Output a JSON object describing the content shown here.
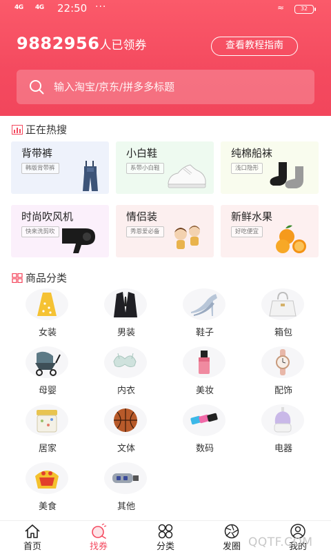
{
  "status_bar": {
    "signal1": "4G",
    "signal2": "4G",
    "time": "22:50",
    "dots": "···",
    "battery": "32"
  },
  "header": {
    "coupon_count": "9882956",
    "coupon_suffix": "人已领券",
    "guide_button": "查看教程指南",
    "search_placeholder": "输入淘宝/京东/拼多多标题",
    "accent_color": "#f44a5f"
  },
  "hot_search": {
    "title": "正在热搜",
    "items": [
      {
        "name": "背带裤",
        "tag": "韩版背带裤",
        "icon": "overalls-image",
        "bg": "#eef2fb"
      },
      {
        "name": "小白鞋",
        "tag": "系带小白鞋",
        "icon": "sneaker-image",
        "bg": "#eefaf0"
      },
      {
        "name": "纯棉船袜",
        "tag": "浅口隐形",
        "icon": "socks-image",
        "bg": "#f9fcee"
      },
      {
        "name": "时尚吹风机",
        "tag": "快来洗剪吹",
        "icon": "hair-dryer-image",
        "bg": "#fbf0fb"
      },
      {
        "name": "情侣装",
        "tag": "秀恩爱必备",
        "icon": "couple-image",
        "bg": "#fcefef"
      },
      {
        "name": "新鲜水果",
        "tag": "好吃便宜",
        "icon": "oranges-image",
        "bg": "#fdf0f0"
      }
    ]
  },
  "categories": {
    "title": "商品分类",
    "items": [
      {
        "label": "女装",
        "icon": "dress-icon"
      },
      {
        "label": "男装",
        "icon": "suit-icon"
      },
      {
        "label": "鞋子",
        "icon": "heels-icon"
      },
      {
        "label": "箱包",
        "icon": "handbag-icon"
      },
      {
        "label": "母婴",
        "icon": "stroller-icon"
      },
      {
        "label": "内衣",
        "icon": "bra-icon"
      },
      {
        "label": "美妆",
        "icon": "cosmetics-icon"
      },
      {
        "label": "配饰",
        "icon": "watch-icon"
      },
      {
        "label": "居家",
        "icon": "storage-jar-icon"
      },
      {
        "label": "文体",
        "icon": "basketball-icon"
      },
      {
        "label": "数码",
        "icon": "usb-drive-icon"
      },
      {
        "label": "电器",
        "icon": "humidifier-icon"
      },
      {
        "label": "美食",
        "icon": "food-icon"
      },
      {
        "label": "其他",
        "icon": "car-charger-icon"
      }
    ]
  },
  "tabbar": {
    "items": [
      {
        "label": "首页",
        "icon": "home-icon",
        "active": false
      },
      {
        "label": "找券",
        "icon": "find-coupon-icon",
        "active": true
      },
      {
        "label": "分类",
        "icon": "category-icon",
        "active": false
      },
      {
        "label": "发圈",
        "icon": "camera-aperture-icon",
        "active": false
      },
      {
        "label": "我的",
        "icon": "user-icon",
        "active": false
      }
    ]
  },
  "watermark": "QQTF.COM"
}
